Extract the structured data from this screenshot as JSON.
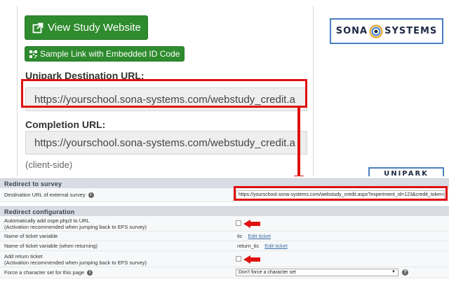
{
  "sona": {
    "study_website_button": "View Study Website",
    "sample_link_button": "Sample Link with Embedded ID Code",
    "unipark_label": "Unipark Destination URL:",
    "unipark_url": "https://yourschool.sona-systems.com/webstudy_credit.a",
    "completion_label": "Completion URL:",
    "completion_url": "https://yourschool.sona-systems.com/webstudy_credit.a",
    "client_side_note": "(client-side)"
  },
  "logos": {
    "sona_left": "SONA",
    "sona_right": "SYSTEMS",
    "unipark": "UNIPARK"
  },
  "unipark_form": {
    "redirect_section_title": "Redirect to survey",
    "dest_url_label": "Destination URL of external survey",
    "dest_url_value": "https://yourschool.sona-systems.com/webstudy_credit.aspx?experiment_id=123&credit_token=",
    "config_section_title": "Redirect configuration",
    "auto_add_label_line1": "Automatically add ospe.php3 to URL",
    "auto_add_label_line2": "(Activation recommended when jumping back to EFS survey)",
    "ticket_var_label": "Name of ticket variable",
    "ticket_var_value": "tic",
    "ticket_var_edit": "Edit ticket",
    "ticket_return_label": "Name of ticket variable (when returning)",
    "ticket_return_value": "return_tic",
    "ticket_return_edit": "Edit ticket",
    "add_return_label_line1": "Add return ticket",
    "add_return_label_line2": "(Activation recommended when jumping back to EFS survey)",
    "charset_label": "Force a character set for this page",
    "charset_value": "Don't force a character set"
  },
  "colors": {
    "button_green": "#2e8b2e",
    "highlight_red": "#e01010",
    "logo_border_blue": "#4a7fc1"
  },
  "icons": [
    "external-link-icon",
    "qr-code-icon",
    "sona-swirl-icon",
    "info-icon",
    "help-icon",
    "red-arrow-icon"
  ]
}
